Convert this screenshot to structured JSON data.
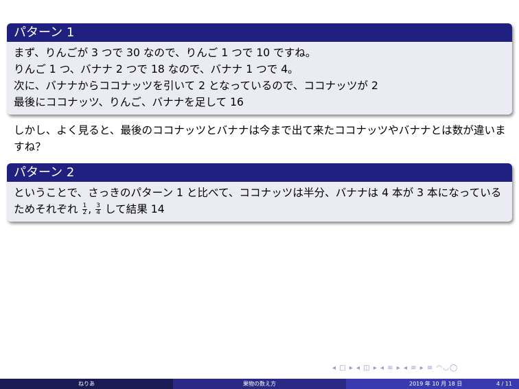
{
  "block1": {
    "title": "パターン 1",
    "lines": [
      "まず、りんごが 3 つで 30 なので、りんご 1 つで 10 ですね。",
      "りんご 1 つ、バナナ 2 つで 18 なので、バナナ 1 つで 4。",
      "次に、バナナからココナッツを引いて 2 となっているので、ココナッツが 2",
      "最後にココナッツ、りんご、バナナを足して 16"
    ]
  },
  "paragraph": "しかし、よく見ると、最後のココナッツとバナナは今まで出て来たココナッツやバナナとは数が違いますね？",
  "block2": {
    "title": "パターン 2",
    "text_before": "ということで、さっきのパターン 1 と比べて、ココナッツは半分、バナナは 4 本が 3 本になっているためそれぞれ",
    "frac1_num": "1",
    "frac1_den": "2",
    "comma": ",",
    "frac2_num": "3",
    "frac2_den": "4",
    "text_after": "して結果 14"
  },
  "nav": {
    "symbols": "◂ □ ▸ ◂ ◫ ▸ ◂ ≡ ▸ ◂ ≡ ▸   ≡   ◠◡◯"
  },
  "footer": {
    "author": "ねりあ",
    "title": "果物の数え方",
    "date": "2019 年 10 月 18 日",
    "page": "4 / 11"
  },
  "colors": {
    "block_title_bg": "#202080",
    "block_body_bg": "#ebebf3",
    "footer_dark": "#1a1a55",
    "footer_mid": "#2a2a85",
    "footer_light": "#3a3ab0"
  }
}
